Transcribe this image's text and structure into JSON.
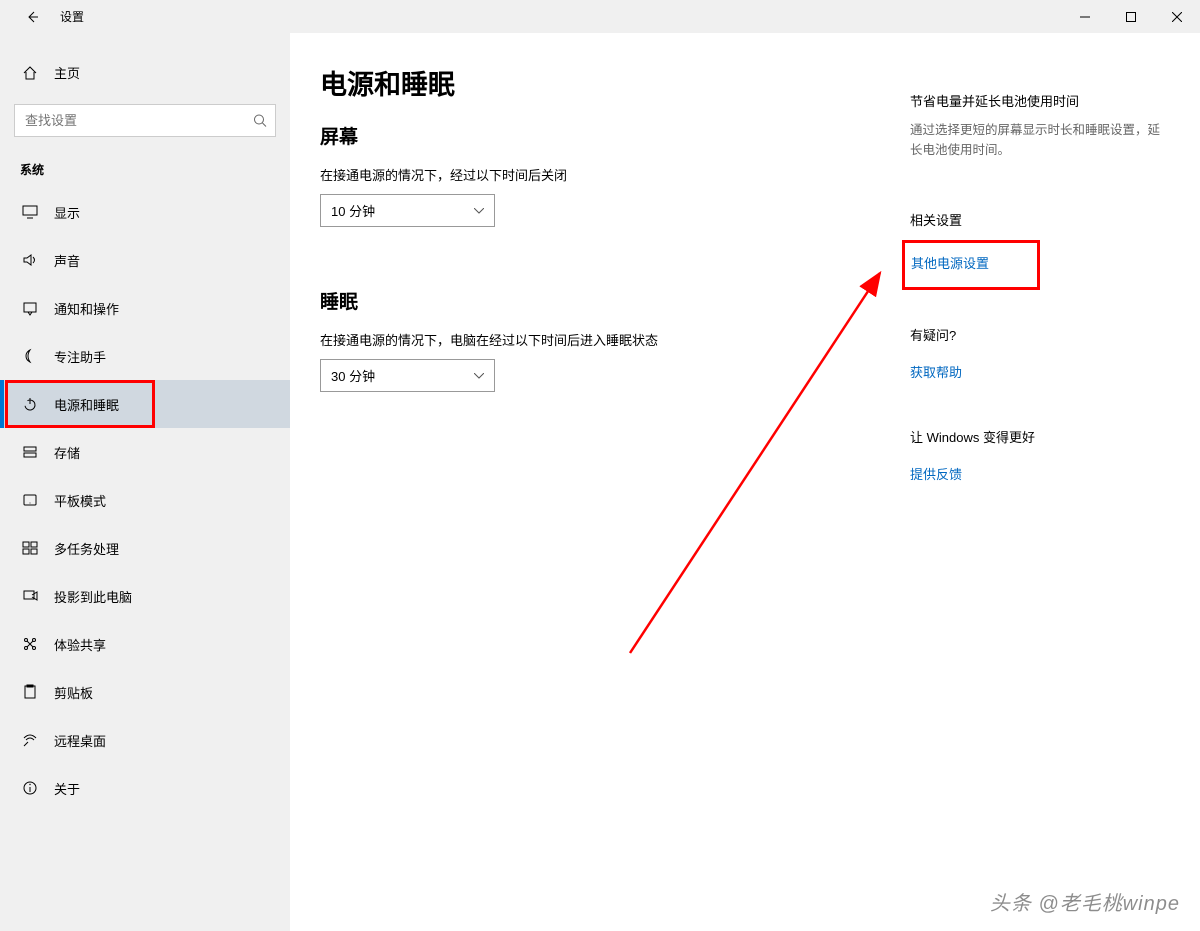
{
  "window": {
    "title": "设置"
  },
  "sidebar": {
    "home_label": "主页",
    "search_placeholder": "查找设置",
    "section_title": "系统",
    "items": [
      {
        "label": "显示",
        "icon": "display"
      },
      {
        "label": "声音",
        "icon": "sound"
      },
      {
        "label": "通知和操作",
        "icon": "notification"
      },
      {
        "label": "专注助手",
        "icon": "focus"
      },
      {
        "label": "电源和睡眠",
        "icon": "power"
      },
      {
        "label": "存储",
        "icon": "storage"
      },
      {
        "label": "平板模式",
        "icon": "tablet"
      },
      {
        "label": "多任务处理",
        "icon": "multitask"
      },
      {
        "label": "投影到此电脑",
        "icon": "project"
      },
      {
        "label": "体验共享",
        "icon": "share"
      },
      {
        "label": "剪贴板",
        "icon": "clipboard"
      },
      {
        "label": "远程桌面",
        "icon": "remote"
      },
      {
        "label": "关于",
        "icon": "about"
      }
    ]
  },
  "content": {
    "page_title": "电源和睡眠",
    "screen": {
      "title": "屏幕",
      "desc": "在接通电源的情况下，经过以下时间后关闭",
      "value": "10 分钟"
    },
    "sleep": {
      "title": "睡眠",
      "desc": "在接通电源的情况下，电脑在经过以下时间后进入睡眠状态",
      "value": "30 分钟"
    }
  },
  "right": {
    "save_title": "节省电量并延长电池使用时间",
    "save_desc": "通过选择更短的屏幕显示时长和睡眠设置，延长电池使用时间。",
    "related_title": "相关设置",
    "related_link": "其他电源设置",
    "question_title": "有疑问?",
    "question_link": "获取帮助",
    "better_title": "让 Windows 变得更好",
    "better_link": "提供反馈"
  },
  "watermark": "头条 @老毛桃winpe"
}
